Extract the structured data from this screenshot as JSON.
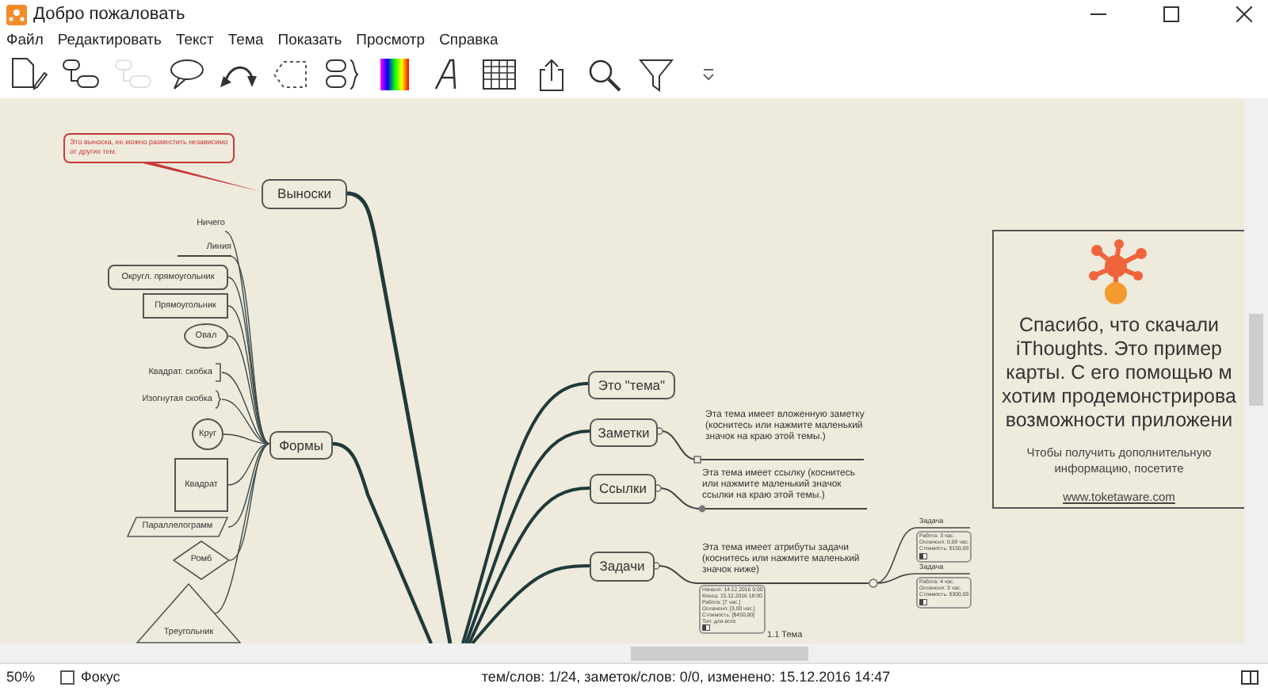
{
  "window": {
    "title": "Добро пожаловать"
  },
  "menu": [
    "Файл",
    "Редактировать",
    "Текст",
    "Тема",
    "Показать",
    "Просмотр",
    "Справка"
  ],
  "toolbar": [
    {
      "kind": "new",
      "disabled": false
    },
    {
      "kind": "topics",
      "disabled": false
    },
    {
      "kind": "topics",
      "disabled": true
    },
    {
      "kind": "callout",
      "disabled": false
    },
    {
      "kind": "relation",
      "disabled": false
    },
    {
      "kind": "boundary",
      "disabled": false
    },
    {
      "kind": "group",
      "disabled": false
    },
    {
      "kind": "color",
      "disabled": false
    },
    {
      "kind": "font",
      "disabled": false
    },
    {
      "kind": "table",
      "disabled": false
    },
    {
      "kind": "share",
      "disabled": false
    },
    {
      "kind": "search",
      "disabled": false
    },
    {
      "kind": "filter",
      "disabled": false
    },
    {
      "kind": "more",
      "disabled": false
    }
  ],
  "map": {
    "callout": "Это выноска, ее можно разместить независимо от других тем.",
    "topics": [
      "Выноски",
      "Формы",
      "Это \"тема\"",
      "Заметки",
      "Ссылки",
      "Задачи"
    ],
    "shapes": [
      {
        "label": "Ничего",
        "kind": "none"
      },
      {
        "label": "Линия",
        "kind": "line"
      },
      {
        "label": "Округл. прямоугольник",
        "kind": "rounded"
      },
      {
        "label": "Прямоугольник",
        "kind": "rect"
      },
      {
        "label": "Овал",
        "kind": "ellipse"
      },
      {
        "label": "Квадрат. скобка",
        "kind": "square-bracket"
      },
      {
        "label": "Изогнутая скобка",
        "kind": "curly-bracket"
      },
      {
        "label": "Круг",
        "kind": "circle"
      },
      {
        "label": "Квадрат",
        "kind": "square"
      },
      {
        "label": "Параллелограмм",
        "kind": "parallelogram"
      },
      {
        "label": "Ромб",
        "kind": "diamond"
      },
      {
        "label": "Треугольник",
        "kind": "triangle"
      }
    ],
    "note_text": "Эта тема имеет вложенную заметку (коснитесь или нажмите маленький значок на краю этой темы.)",
    "link_text": "Эта тема имеет ссылку (коснитесь или нажмите маленький значок ссылки на краю этой темы.)",
    "task_text": "Эта тема имеет атрибуты задачи (коснитесь или нажмите маленький значок ниже)",
    "task_details": [
      "Начало: 14.12.2016 9:00",
      "Конец: 15.12.2016 18:00",
      "Работа: [7 час.]",
      "Оплачено: [3,00 час.]",
      "Стоимость: [$450,00]",
      "Тип: для всех"
    ],
    "subtasks": [
      {
        "label": "Задача",
        "details": [
          "Работа: 3 час.",
          "Оплачено: 0,00 час.",
          "Стоимость: $150,00"
        ]
      },
      {
        "label": "Задача",
        "details": [
          "Работа: 4 час.",
          "Оплачено: 3 час.",
          "Стоимость: $300,00"
        ]
      }
    ],
    "caption": "1.1 Тема"
  },
  "welcome_card": {
    "lines": [
      "Спасибо, что скачали",
      "iThoughts. Это пример",
      "карты. С его помощью м",
      "хотим продемонстрирова",
      "возможности приложени"
    ],
    "info": "Чтобы получить дополнительную информацию, посетите",
    "link": "www.toketaware.com"
  },
  "status_bar": {
    "zoom": "50%",
    "focus": {
      "label": "Фокус",
      "checked": false
    },
    "info": "тем/слов: 1/24, заметок/слов: 0/0, изменено: 15.12.2016 14:47"
  }
}
